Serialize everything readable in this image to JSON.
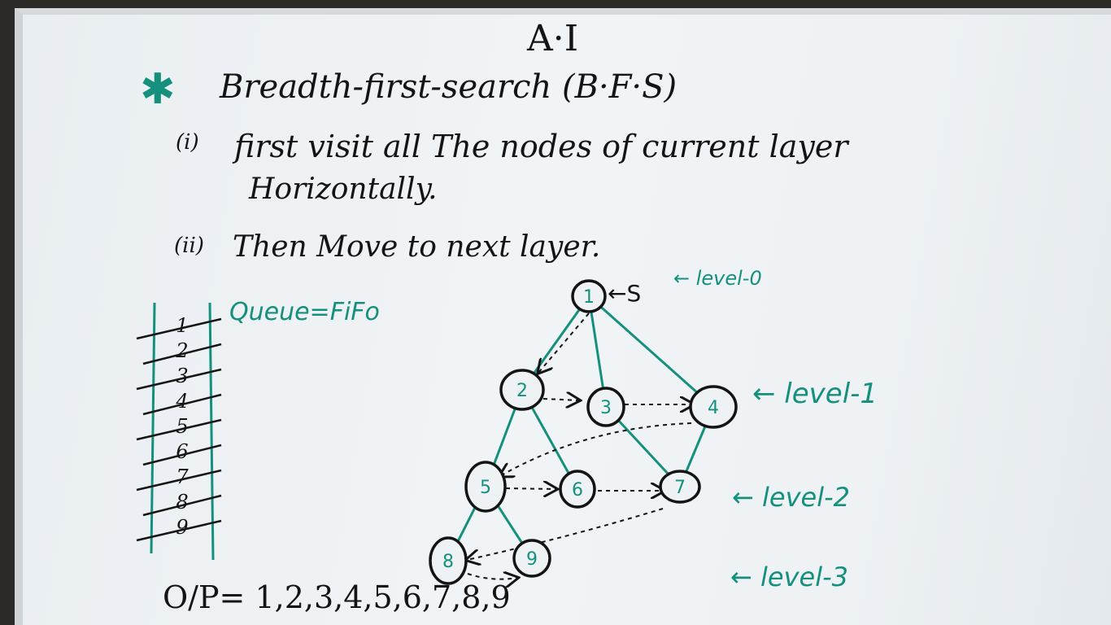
{
  "board": {
    "title": "A·I",
    "heading": "Breadth-first-search (B·F·S)",
    "point1_num": "(i)",
    "point1_text": "first visit all The nodes of current layer",
    "point1_cont": "Horizontally.",
    "point2_num": "(ii)",
    "point2_text": "Then Move to next layer.",
    "queue_label": "Queue=FiFo",
    "queue_items": [
      "1",
      "2",
      "3",
      "4",
      "5",
      "6",
      "7",
      "8",
      "9"
    ],
    "start_marker": "←S",
    "levels": [
      "← level-0",
      "← level-1",
      "← level-2",
      "← level-3"
    ],
    "output": "O/P= 1,2,3,4,5,6,7,8,9"
  },
  "graph": {
    "nodes": [
      "1",
      "2",
      "3",
      "4",
      "5",
      "6",
      "7",
      "8",
      "9"
    ],
    "edges": [
      [
        "1",
        "2"
      ],
      [
        "1",
        "3"
      ],
      [
        "1",
        "4"
      ],
      [
        "2",
        "5"
      ],
      [
        "2",
        "6"
      ],
      [
        "3",
        "7"
      ],
      [
        "4",
        "7"
      ],
      [
        "5",
        "8"
      ],
      [
        "5",
        "9"
      ]
    ]
  },
  "colors": {
    "marker_green": "#14907d",
    "marker_black": "#141414",
    "board": "#eef2f5"
  }
}
